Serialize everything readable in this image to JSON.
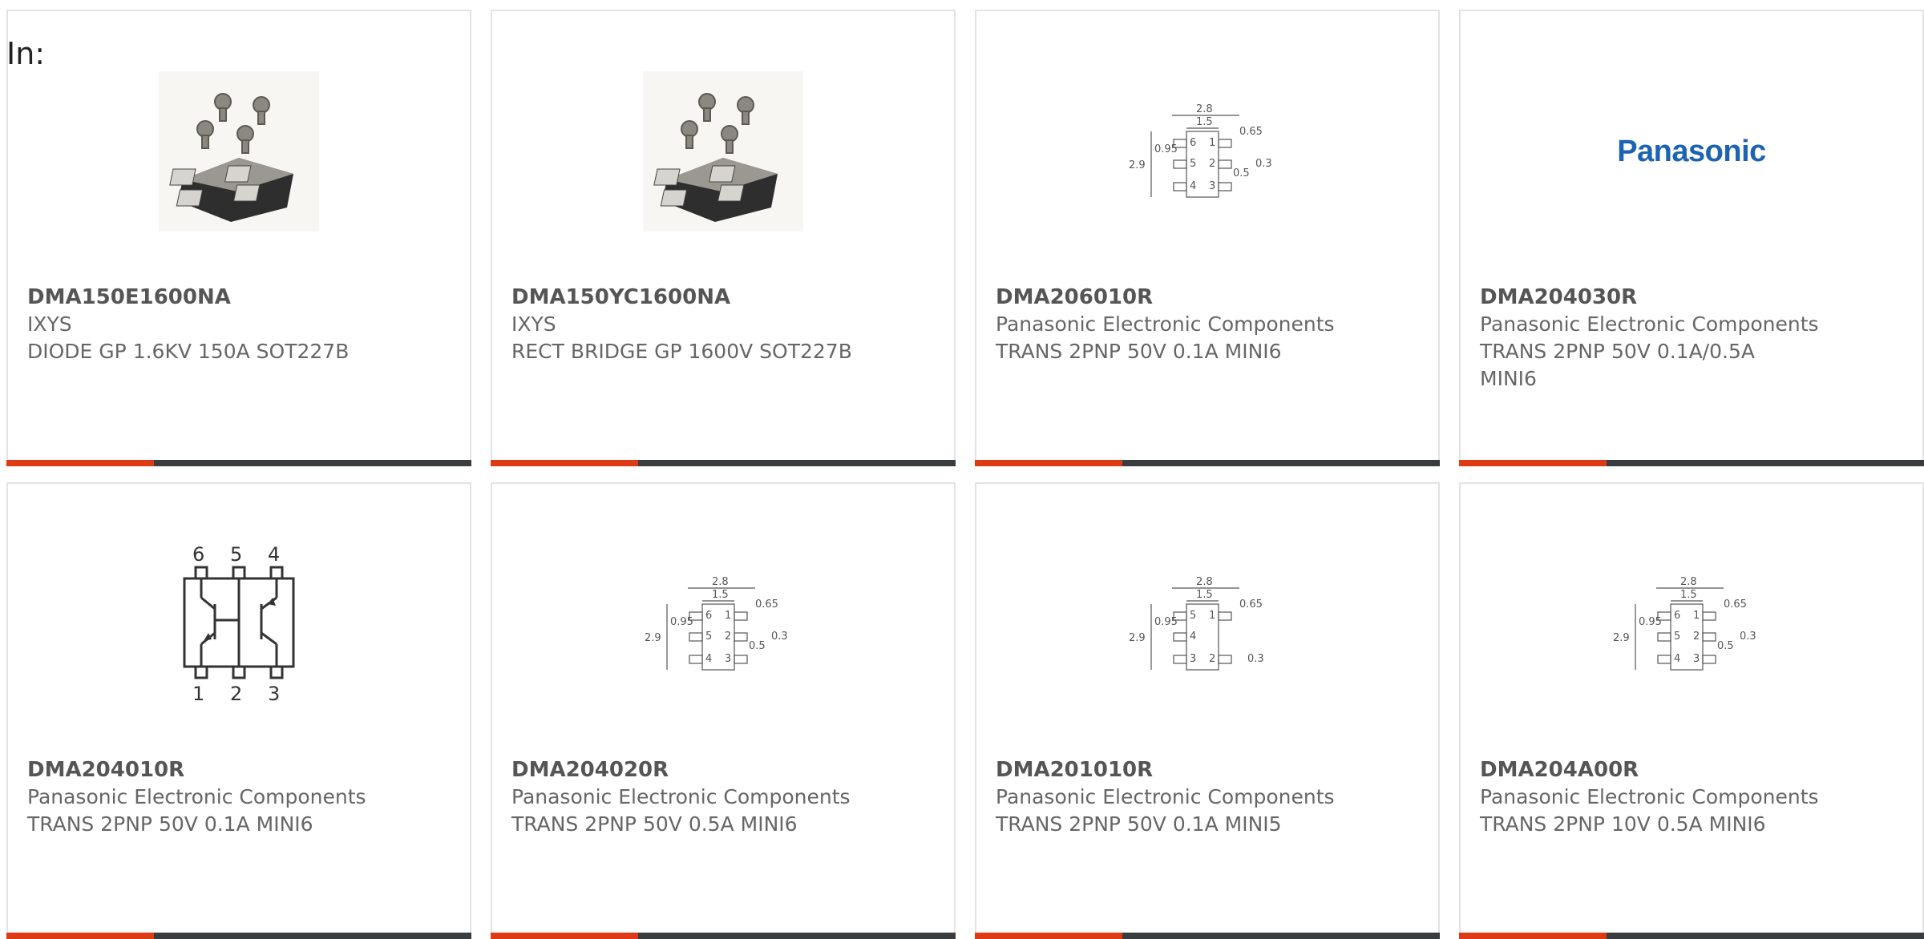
{
  "filter_label": "In:",
  "colors": {
    "accent": "#dd3a16",
    "bar_dark": "#3a3d40",
    "brand_blue": "#1d63b4"
  },
  "products": [
    {
      "part": "DMA150E1600NA",
      "maker": "IXYS",
      "desc": "DIODE GP 1.6KV 150A SOT227B",
      "image": "module-icon"
    },
    {
      "part": "DMA150YC1600NA",
      "maker": "IXYS",
      "desc": "RECT BRIDGE GP 1600V SOT227B",
      "image": "module-icon"
    },
    {
      "part": "DMA206010R",
      "maker": "Panasonic Electronic Components",
      "desc": "TRANS 2PNP 50V 0.1A MINI6",
      "image": "package-diagram"
    },
    {
      "part": "DMA204030R",
      "maker": "Panasonic Electronic Components",
      "desc": "TRANS 2PNP 50V 0.1A/0.5A MINI6",
      "image": "brand-logo",
      "logo_text": "Panasonic"
    },
    {
      "part": "DMA204010R",
      "maker": "Panasonic Electronic Components",
      "desc": "TRANS 2PNP 50V 0.1A MINI6",
      "image": "schematic-diagram"
    },
    {
      "part": "DMA204020R",
      "maker": "Panasonic Electronic Components",
      "desc": "TRANS 2PNP 50V 0.5A MINI6",
      "image": "package-diagram"
    },
    {
      "part": "DMA201010R",
      "maker": "Panasonic Electronic Components",
      "desc": "TRANS 2PNP 50V 0.1A MINI5",
      "image": "package-diagram-5"
    },
    {
      "part": "DMA204A00R",
      "maker": "Panasonic Electronic Components",
      "desc": "TRANS 2PNP 10V 0.5A MINI6",
      "image": "package-diagram"
    }
  ]
}
